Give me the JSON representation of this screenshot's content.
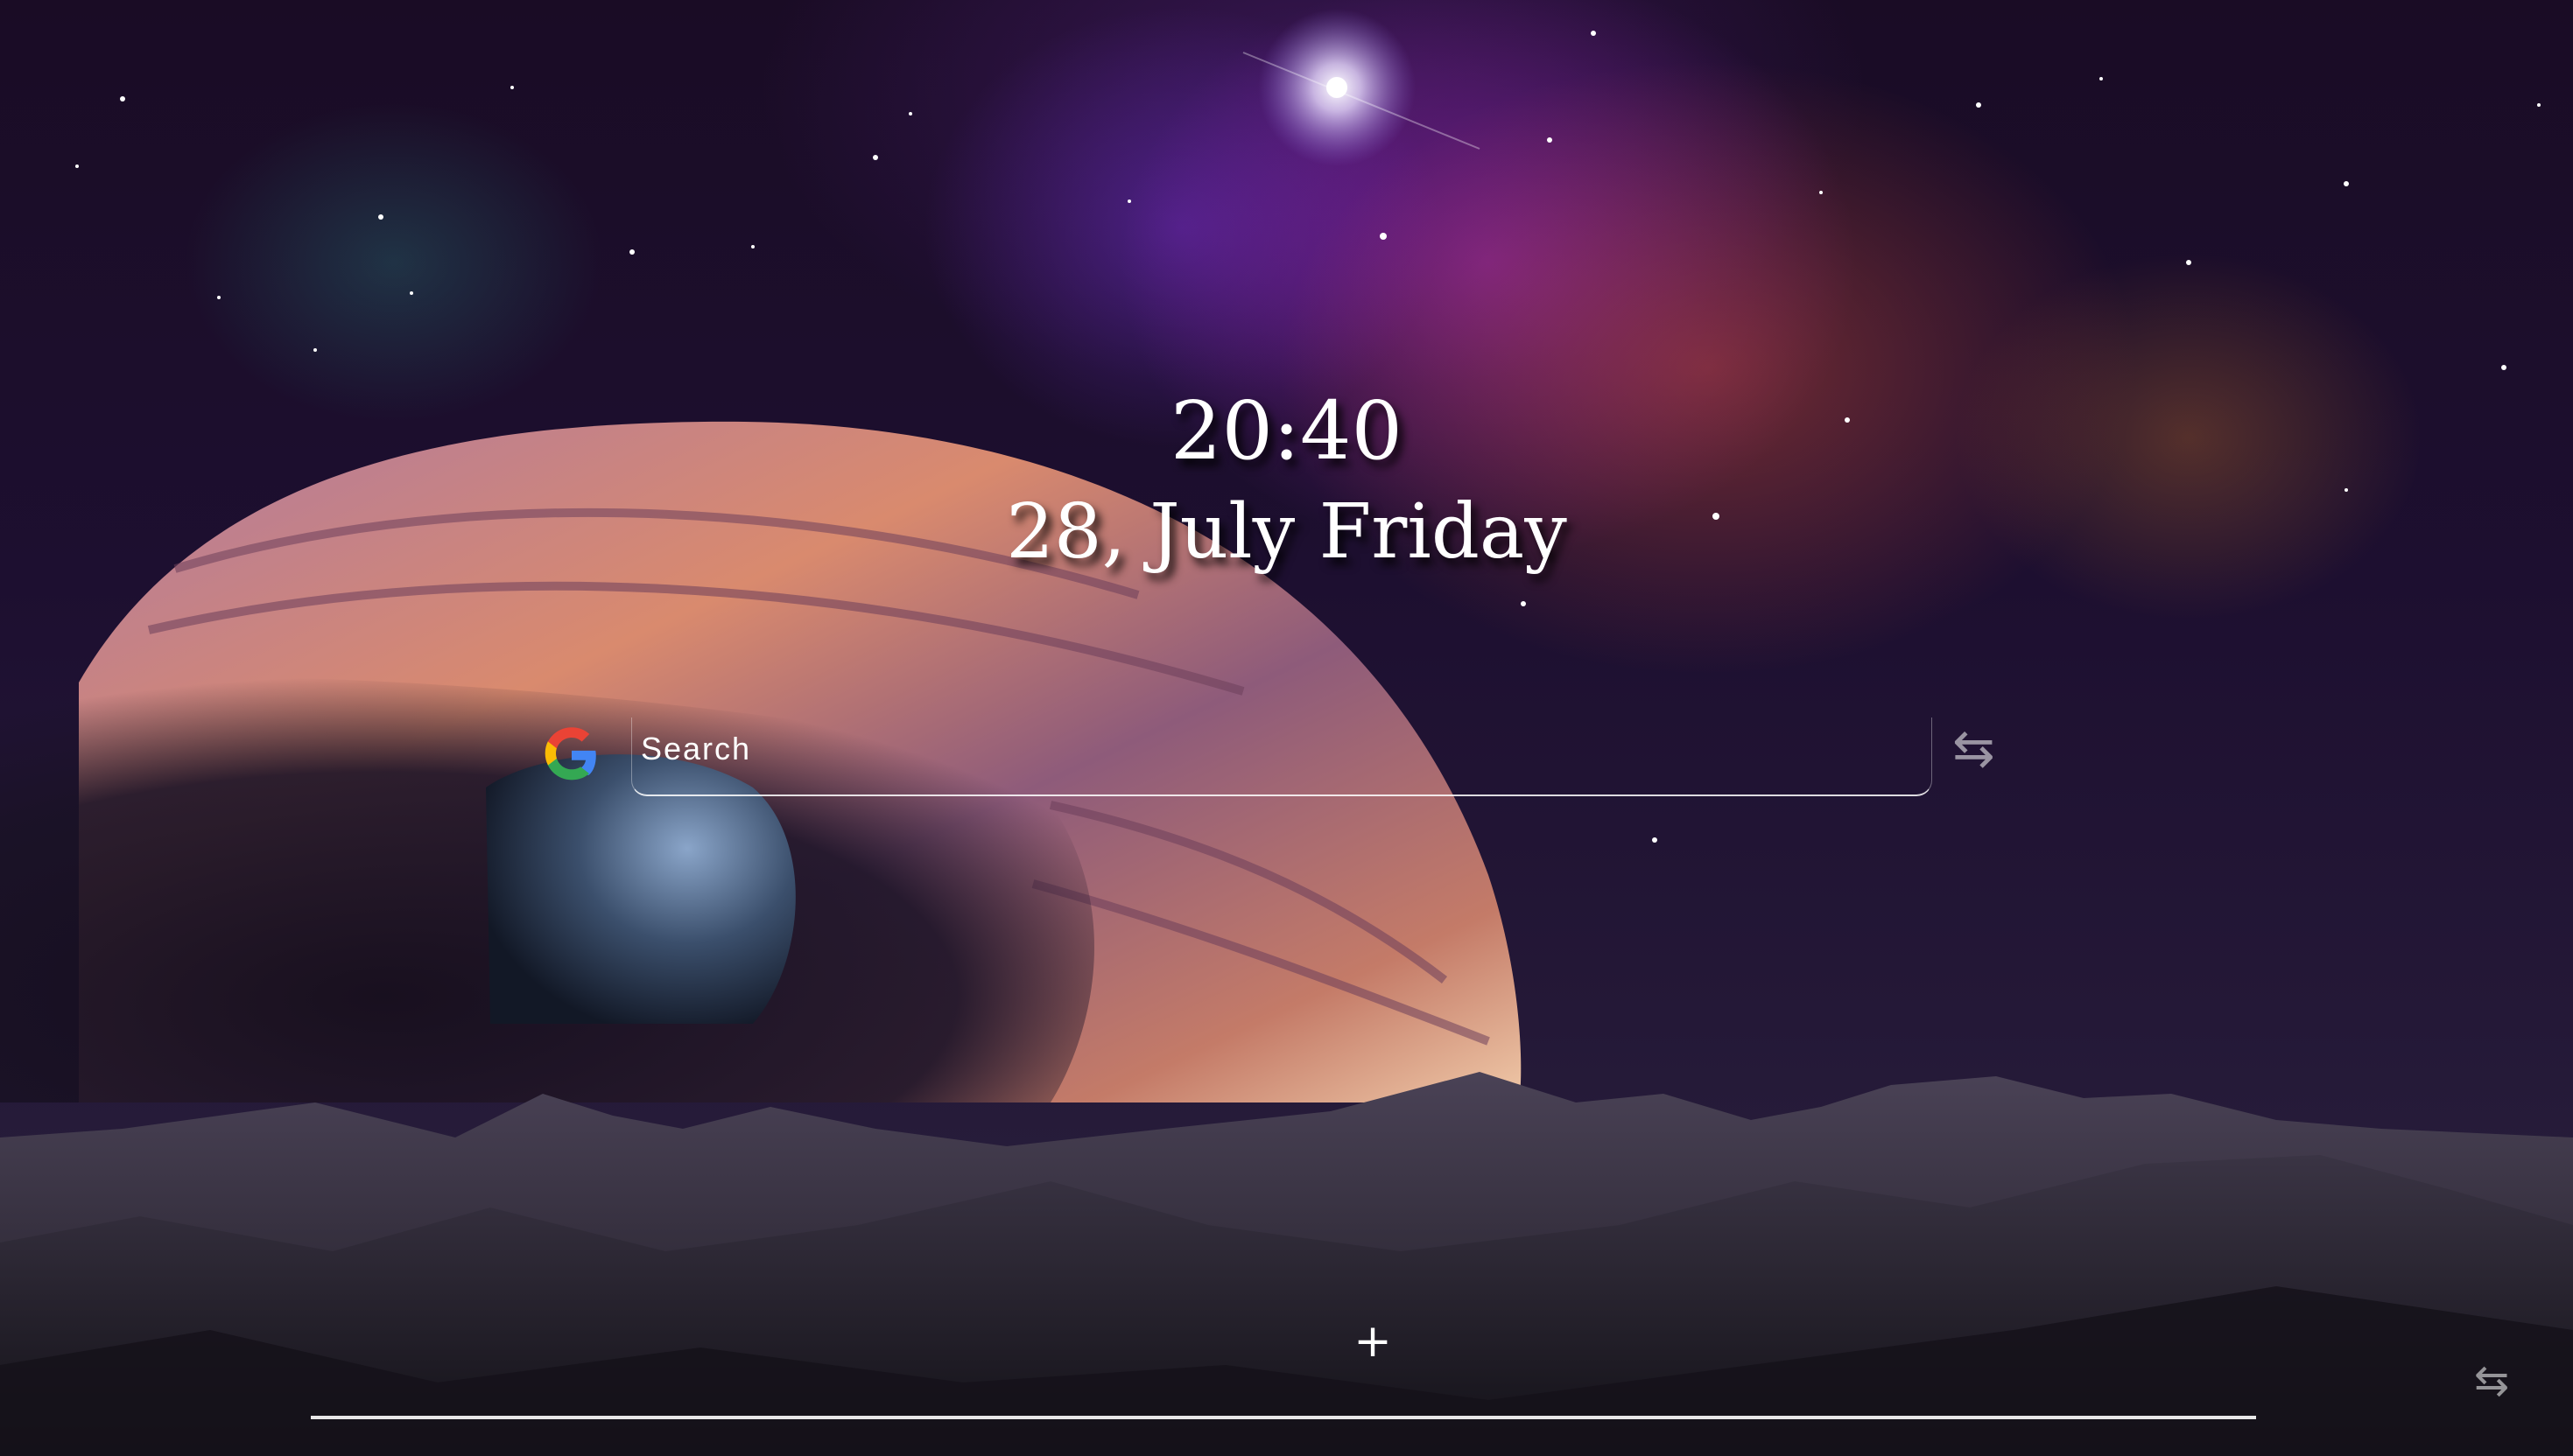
{
  "clock": {
    "time": "20:40",
    "date": "28, July Friday"
  },
  "search": {
    "engine_icon": "google-logo-icon",
    "placeholder": "Search",
    "switch_icon": "swap-arrows-icon"
  },
  "shortcuts": {
    "add_icon": "plus-icon",
    "add_label": "+",
    "switch_icon": "swap-arrows-icon"
  },
  "colors": {
    "text": "#ffffff",
    "google_blue": "#4285F4",
    "google_red": "#EA4335",
    "google_yellow": "#FBBC05",
    "google_green": "#34A853"
  }
}
